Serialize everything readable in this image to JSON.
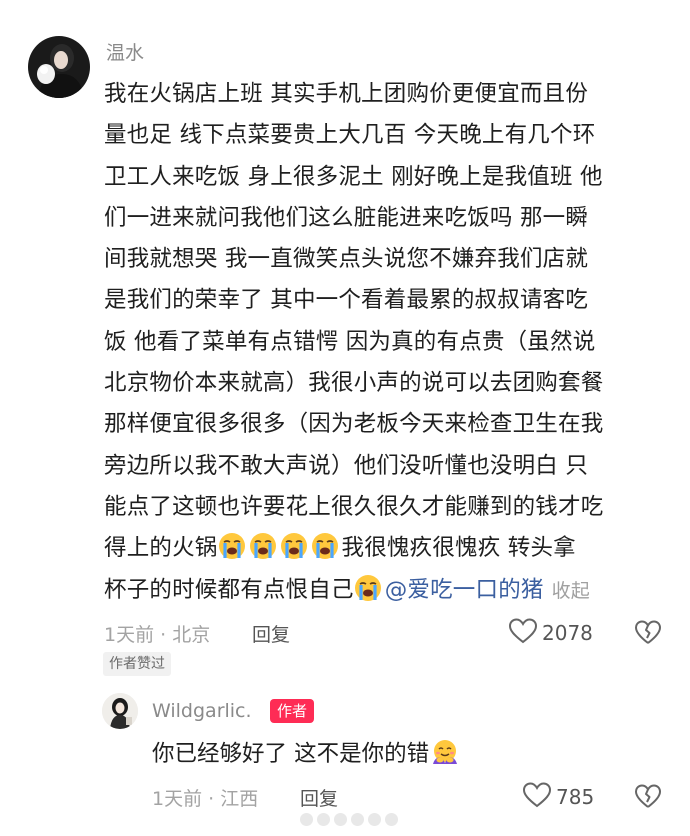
{
  "main_comment": {
    "username": "温水",
    "avatar_icon": "user-avatar-photo",
    "lines": [
      "我在火锅店上班 其实手机上团购价更便宜而且份",
      "量也足 线下点菜要贵上大几百 今天晚上有几个环",
      "卫工人来吃饭 身上很多泥土 刚好晚上是我值班 他",
      "们一进来就问我他们这么脏能进来吃饭吗 那一瞬",
      "间我就想哭 我一直微笑点头说您不嫌弃我们店就",
      "是我们的荣幸了 其中一个看着最累的叔叔请客吃",
      "饭 他看了菜单有点错愕 因为真的有点贵（虽然说",
      "北京物价本来就高）我很小声的说可以去团购套餐",
      "那样便宜很多很多（因为老板今天来检查卫生在我",
      "旁边所以我不敢大声说）他们没听懂也没明白 只",
      "能点了这顿也许要花上很久很久才能赚到的钱才吃"
    ],
    "line12_prefix": "得上的火锅",
    "line12_suffix": "我很愧疚很愧疚 转头拿",
    "line13_prefix": "杯子的时候都有点恨自己",
    "mention": "@爱吃一口的猪",
    "collapse_label": "收起",
    "meta": "1天前 · 北京",
    "reply_label": "回复",
    "like_count": "2078",
    "author_liked_badge": "作者赞过"
  },
  "reply_comment": {
    "username": "Wildgarlic.",
    "author_badge": "作者",
    "avatar_icon": "user-avatar-photo",
    "text": "你已经够好了 这不是你的错",
    "meta": "1天前 · 江西",
    "reply_label": "回复",
    "like_count": "785"
  },
  "icons": {
    "emoji": "loudly-crying-face-emoji",
    "hug_emoji": "hugging-face-emoji",
    "like": "heart-outline-icon",
    "dislike": "broken-heart-icon"
  },
  "colors": {
    "accent": "#fe2c55",
    "mention": "#3b5fa0",
    "meta": "#a3a3a3"
  }
}
